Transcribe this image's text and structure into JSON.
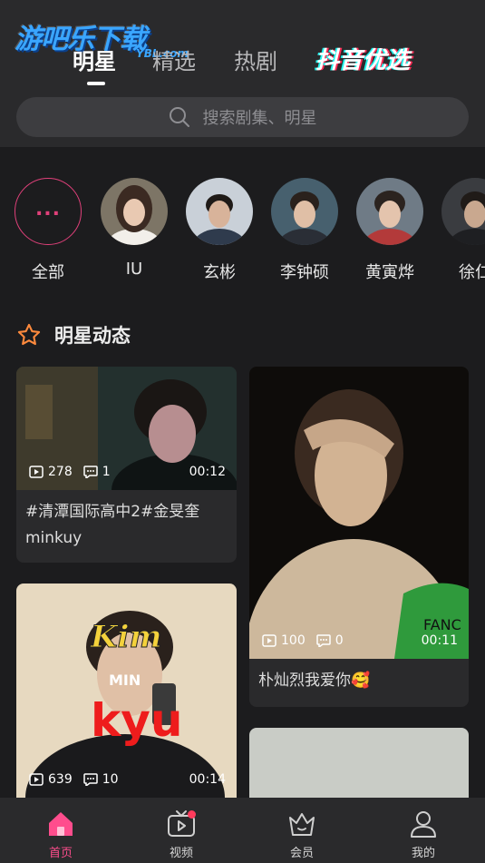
{
  "brand": {
    "logo": "游吧乐下载",
    "logo_sub": "YBL.com"
  },
  "tabs": [
    {
      "label": "明星",
      "active": true
    },
    {
      "label": "精选",
      "active": false
    },
    {
      "label": "热剧",
      "active": false
    },
    {
      "label": "抖音优选",
      "active": false
    }
  ],
  "search": {
    "placeholder": "搜索剧集、明星"
  },
  "stars": [
    {
      "name": "全部",
      "icon": "more-dots-icon"
    },
    {
      "name": "IU"
    },
    {
      "name": "玄彬"
    },
    {
      "name": "李钟硕"
    },
    {
      "name": "黄寅烨"
    },
    {
      "name": "徐仁"
    }
  ],
  "section": {
    "title": "明星动态",
    "icon": "star-outline-icon"
  },
  "feed": [
    {
      "views": "278",
      "comments": "1",
      "duration": "00:12",
      "caption": "#清潭国际高中2#金旻奎 minkuy"
    },
    {
      "views": "100",
      "comments": "0",
      "duration": "00:11",
      "caption": "朴灿烈我爱你🥰"
    },
    {
      "views": "639",
      "comments": "10",
      "duration": "00:14",
      "overlay_text": [
        "Kim",
        "MIN",
        "kyu"
      ]
    },
    {
      "overlay_text": [
        "FANC"
      ]
    }
  ],
  "nav": [
    {
      "label": "首页",
      "icon": "home-icon",
      "active": true
    },
    {
      "label": "视频",
      "icon": "tv-icon",
      "badge": true
    },
    {
      "label": "会员",
      "icon": "crown-icon"
    },
    {
      "label": "我的",
      "icon": "user-icon"
    }
  ],
  "colors": {
    "accent": "#ff4d8d",
    "background": "#1c1c1e",
    "surface": "#2a2a2c",
    "section_icon": "#ff8a3d"
  }
}
